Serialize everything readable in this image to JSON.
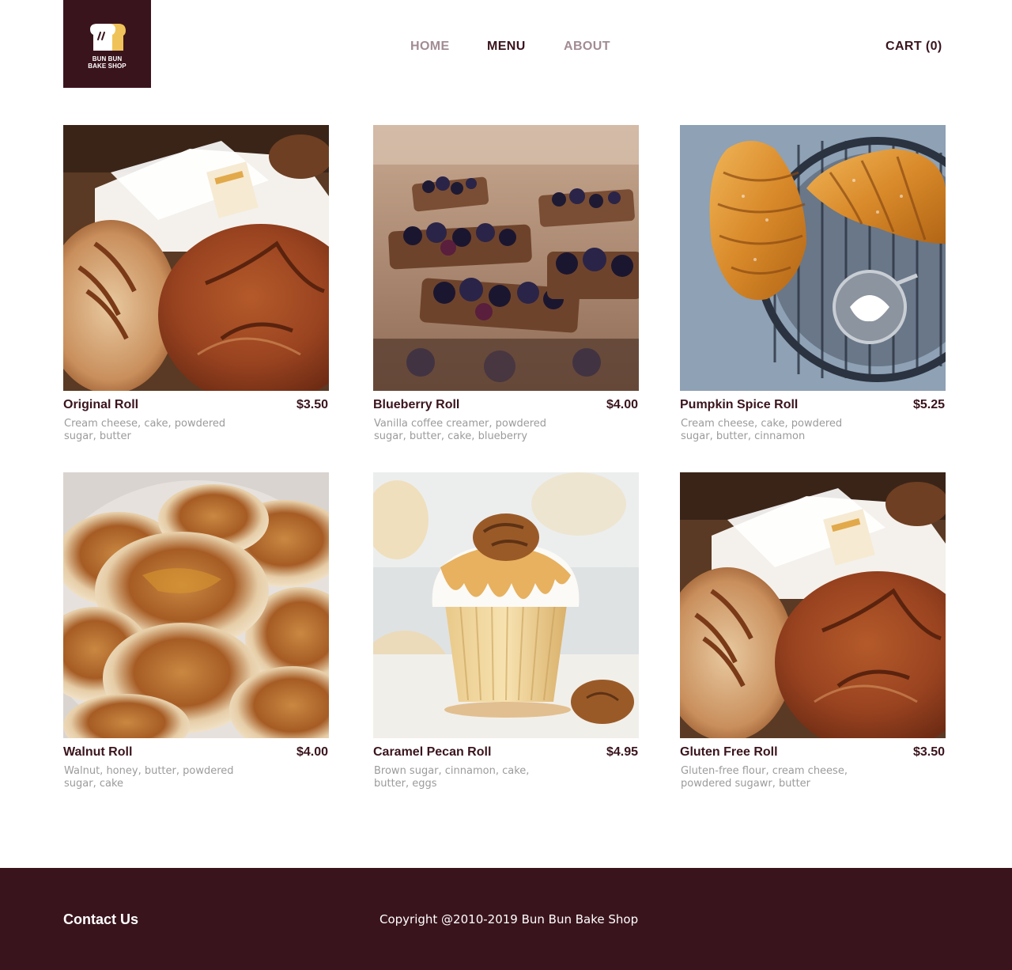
{
  "brand": {
    "line1": "BUN BUN",
    "line2": "BAKE SHOP",
    "logo_icon": "bread-slices-icon",
    "bg_color": "#3a141d",
    "accent_color": "#f0c35a"
  },
  "nav": {
    "home": "HOME",
    "menu": "MENU",
    "about": "ABOUT",
    "cart": "CART (0)",
    "active": "MENU",
    "inactive_color": "#a28c93",
    "active_color": "#3a141d"
  },
  "products": [
    {
      "name": "Original Roll",
      "price": "$3.50",
      "description": "Cream cheese, cake, powdered sugar, butter",
      "image": "bread-loaves-photo"
    },
    {
      "name": "Blueberry Roll",
      "price": "$4.00",
      "description": "Vanilla coffee creamer, powdered sugar, butter, cake, blueberry",
      "image": "blueberry-pastries-photo"
    },
    {
      "name": "Pumpkin Spice Roll",
      "price": "$5.25",
      "description": "Cream cheese, cake, powdered sugar, butter, cinnamon",
      "image": "croissants-photo"
    },
    {
      "name": "Walnut Roll",
      "price": "$4.00",
      "description": "Walnut, honey, butter, powdered sugar, cake",
      "image": "pancakes-photo"
    },
    {
      "name": "Caramel Pecan Roll",
      "price": "$4.95",
      "description": "Brown sugar, cinnamon, cake, butter, eggs",
      "image": "caramel-cupcake-photo"
    },
    {
      "name": "Gluten Free Roll",
      "price": "$3.50",
      "description": "Gluten-free flour, cream cheese, powdered sugawr, butter",
      "image": "bread-loaves-photo"
    }
  ],
  "footer": {
    "contact": "Contact Us",
    "copyright": "Copyright @2010-2019 Bun Bun Bake Shop"
  }
}
